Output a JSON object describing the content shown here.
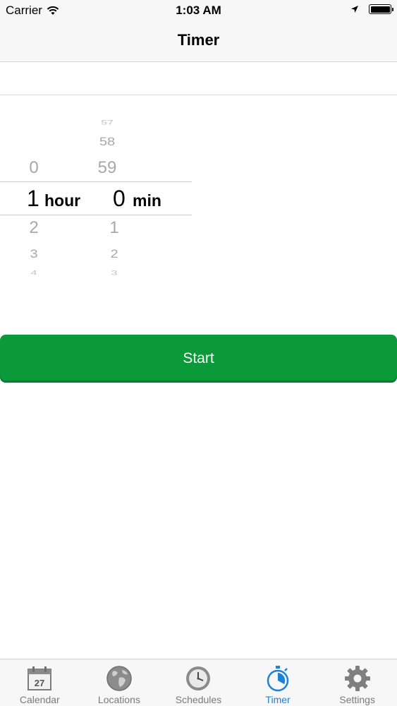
{
  "status_bar": {
    "carrier": "Carrier",
    "time": "1:03 AM",
    "battery_level": 1.0,
    "icons": [
      "wifi-icon",
      "location-arrow-icon",
      "battery-icon"
    ]
  },
  "nav": {
    "title": "Timer"
  },
  "picker": {
    "hours": {
      "above": [
        "0"
      ],
      "selected": "1",
      "unit": "hour",
      "below": [
        "2",
        "3",
        "4"
      ]
    },
    "minutes": {
      "above": [
        "57",
        "58",
        "59"
      ],
      "selected": "0",
      "unit": "min",
      "below": [
        "1",
        "2",
        "3"
      ]
    }
  },
  "start_button": {
    "label": "Start",
    "color": "#0a9a3a"
  },
  "tab_bar": {
    "active_color": "#1a82d8",
    "calendar_day": "27",
    "tabs": [
      {
        "label": "Calendar",
        "icon": "calendar-icon",
        "active": false
      },
      {
        "label": "Locations",
        "icon": "globe-icon",
        "active": false
      },
      {
        "label": "Schedules",
        "icon": "clock-icon",
        "active": false
      },
      {
        "label": "Timer",
        "icon": "stopwatch-icon",
        "active": true
      },
      {
        "label": "Settings",
        "icon": "gear-icon",
        "active": false
      }
    ]
  }
}
